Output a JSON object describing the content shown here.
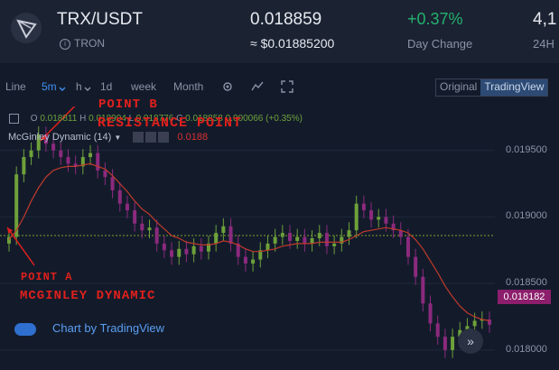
{
  "header": {
    "pair": "TRX/USDT",
    "coin_name": "TRON",
    "price": "0.018859",
    "usd_price": "≈ $0.01885200",
    "change": "+0.37%",
    "change_label": "Day Change",
    "volume_partial": "4,1",
    "volume_label": "24H"
  },
  "toolbar": {
    "line": "Line",
    "interval": "5m",
    "hour": "h",
    "day": "1d",
    "week": "week",
    "month": "Month",
    "view_original": "Original",
    "view_tradingview": "TradingView"
  },
  "legend": {
    "o_label": "O",
    "o_value": "0.018811",
    "h_label": "H",
    "h_value": "0.018904",
    "l_label": "L",
    "l_value": "0.018776",
    "c_label": "C",
    "c_value": "0.018858",
    "change": "0.000066 (+0.35%)",
    "indicator": "McGinley Dynamic (14)",
    "indicator_value": "0.0188"
  },
  "annotations": {
    "point_b": "POINT B",
    "resistance": "RESISTANCE POINT",
    "point_a": "POINT A",
    "mcginley": "MCGINLEY DYNAMIC"
  },
  "credit": "Chart by TradingView",
  "price_tag": "0.018182",
  "colors": {
    "up": "#6ea13a",
    "down": "#8b2a7d",
    "ma": "#c0392b",
    "ref_line": "#7fa12a"
  },
  "chart_data": {
    "type": "line",
    "title": "",
    "xlabel": "",
    "ylabel": "",
    "ylim": [
      0.01785,
      0.01983
    ],
    "y_ticks": [
      "0.019500",
      "0.019000",
      "0.018500",
      "0.018000"
    ],
    "series": [
      {
        "type": "candlestick_close",
        "values": [
          0.01885,
          0.01932,
          0.01945,
          0.0195,
          0.01962,
          0.01955,
          0.0195,
          0.01945,
          0.0194,
          0.01938,
          0.01945,
          0.01948,
          0.01935,
          0.0193,
          0.0192,
          0.0191,
          0.01905,
          0.01895,
          0.0189,
          0.01892,
          0.0188,
          0.01875,
          0.0187,
          0.01876,
          0.01872,
          0.01878,
          0.01874,
          0.0188,
          0.01888,
          0.01893,
          0.0188,
          0.0187,
          0.01865,
          0.01868,
          0.01875,
          0.0188,
          0.01885,
          0.01888,
          0.01882,
          0.01885,
          0.0188,
          0.01884,
          0.01888,
          0.01878,
          0.0188,
          0.01885,
          0.0189,
          0.0191,
          0.01905,
          0.01898,
          0.019,
          0.01895,
          0.0189,
          0.01885,
          0.0187,
          0.01855,
          0.01835,
          0.0182,
          0.0181,
          0.018,
          0.0181,
          0.01815,
          0.01818,
          0.01822,
          0.01823,
          0.01819
        ]
      },
      {
        "name": "McGinley Dynamic (14)",
        "values": [
          0.01883,
          0.0189,
          0.019,
          0.01912,
          0.01922,
          0.0193,
          0.01935,
          0.01937,
          0.01938,
          0.01938,
          0.01939,
          0.0194,
          0.01938,
          0.01936,
          0.01931,
          0.01925,
          0.01919,
          0.01912,
          0.01906,
          0.01902,
          0.01896,
          0.01891,
          0.01886,
          0.01884,
          0.01881,
          0.0188,
          0.01879,
          0.01879,
          0.0188,
          0.01882,
          0.01881,
          0.01879,
          0.01876,
          0.01874,
          0.01874,
          0.01875,
          0.01876,
          0.01878,
          0.01879,
          0.0188,
          0.0188,
          0.0188,
          0.01881,
          0.01881,
          0.01881,
          0.01881,
          0.01883,
          0.01886,
          0.01889,
          0.0189,
          0.01891,
          0.01892,
          0.01891,
          0.0189,
          0.01888,
          0.01883,
          0.01876,
          0.01867,
          0.01858,
          0.01848,
          0.0184,
          0.01833,
          0.01828,
          0.01825,
          0.01823,
          0.01822
        ]
      }
    ],
    "reference_price": 0.01886
  }
}
